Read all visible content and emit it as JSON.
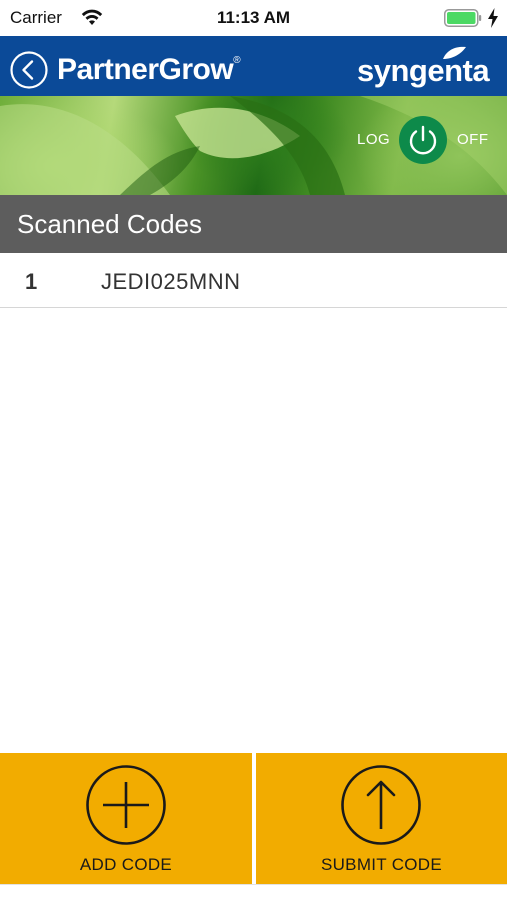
{
  "status_bar": {
    "carrier": "Carrier",
    "time": "11:13 AM",
    "icons": [
      "wifi-icon",
      "battery-icon",
      "charging-bolt-icon"
    ]
  },
  "header": {
    "back_icon": "chevron-left-circle-icon",
    "brand_left": "PartnerGrow",
    "brand_left_mark": "®",
    "brand_right": "syngenta",
    "background_color": "#0b4a98"
  },
  "banner": {
    "logoff_left": "LOG",
    "logoff_right": "OFF",
    "logoff_icon": "power-icon",
    "logoff_color": "#0d8a4a"
  },
  "section": {
    "title": "Scanned Codes",
    "background_color": "#5d5d5d"
  },
  "codes": [
    {
      "index": "1",
      "value": "JEDI025MNN"
    }
  ],
  "actions": {
    "add": {
      "label": "ADD CODE",
      "icon": "plus-circle-icon"
    },
    "submit": {
      "label": "SUBMIT CODE",
      "icon": "arrow-up-circle-icon"
    },
    "background_color": "#f2ac00"
  }
}
